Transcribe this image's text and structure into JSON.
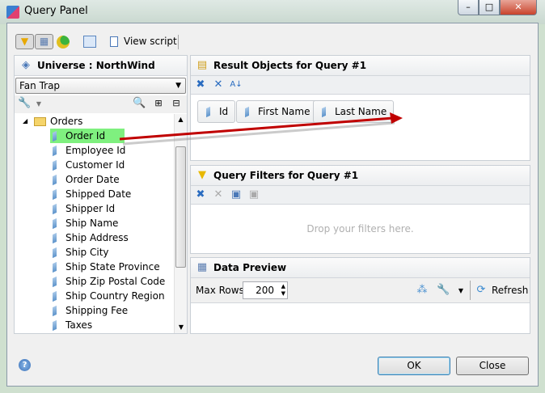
{
  "window": {
    "title": "Query Panel",
    "minimize": "–",
    "maximize": "□",
    "close": "✕"
  },
  "toolbar": {
    "view_script": "View script"
  },
  "universe": {
    "title": "Universe : NorthWind Busines...",
    "context": "Fan Trap",
    "tree": {
      "folder": "Orders",
      "selected": "Order Id",
      "items": [
        "Order Id",
        "Employee Id",
        "Customer Id",
        "Order Date",
        "Shipped Date",
        "Shipper Id",
        "Ship Name",
        "Ship Address",
        "Ship City",
        "Ship State Province",
        "Ship Zip Postal Code",
        "Ship Country Region",
        "Shipping Fee",
        "Taxes"
      ]
    }
  },
  "result": {
    "title": "Result Objects for Query #1",
    "objects": [
      "Id",
      "First Name",
      "Last Name"
    ]
  },
  "filters": {
    "title": "Query Filters for Query #1",
    "placeholder": "Drop your filters here."
  },
  "preview": {
    "title": "Data Preview",
    "max_rows_label": "Max Rows",
    "max_rows": "200",
    "refresh": "Refresh"
  },
  "footer": {
    "ok": "OK",
    "close": "Close",
    "help": "?"
  },
  "colors": {
    "selection": "#7ff07f",
    "arrow": "#c00000"
  }
}
